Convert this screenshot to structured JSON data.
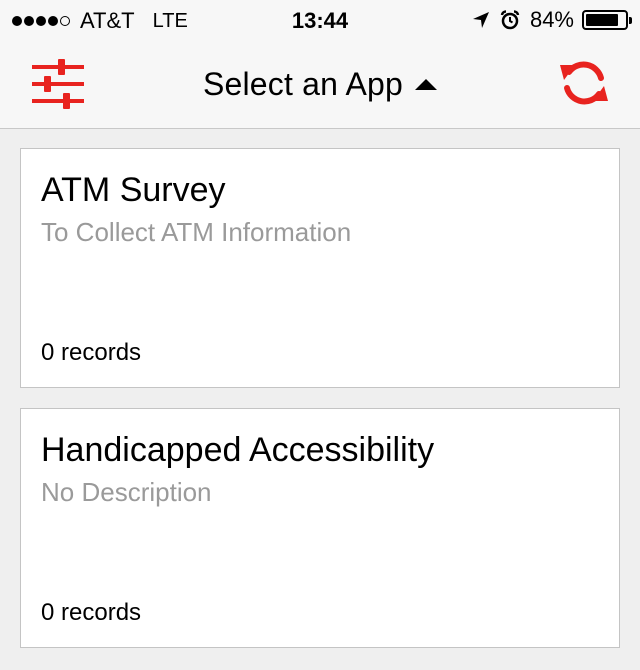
{
  "status_bar": {
    "signal_filled": 4,
    "signal_total": 5,
    "carrier": "AT&T",
    "network": "LTE",
    "time": "13:44",
    "icons": [
      "location-arrow-icon",
      "alarm-clock-icon"
    ],
    "battery_percent_label": "84%",
    "battery_level": 0.84
  },
  "nav": {
    "title": "Select an App",
    "left_icon": "sliders-icon",
    "right_icon": "refresh-icon",
    "accent_color": "#e8231f"
  },
  "apps": [
    {
      "title": "ATM Survey",
      "description": "To Collect ATM Information",
      "records": "0 records"
    },
    {
      "title": "Handicapped Accessibility",
      "description": "No Description",
      "records": "0 records"
    }
  ]
}
